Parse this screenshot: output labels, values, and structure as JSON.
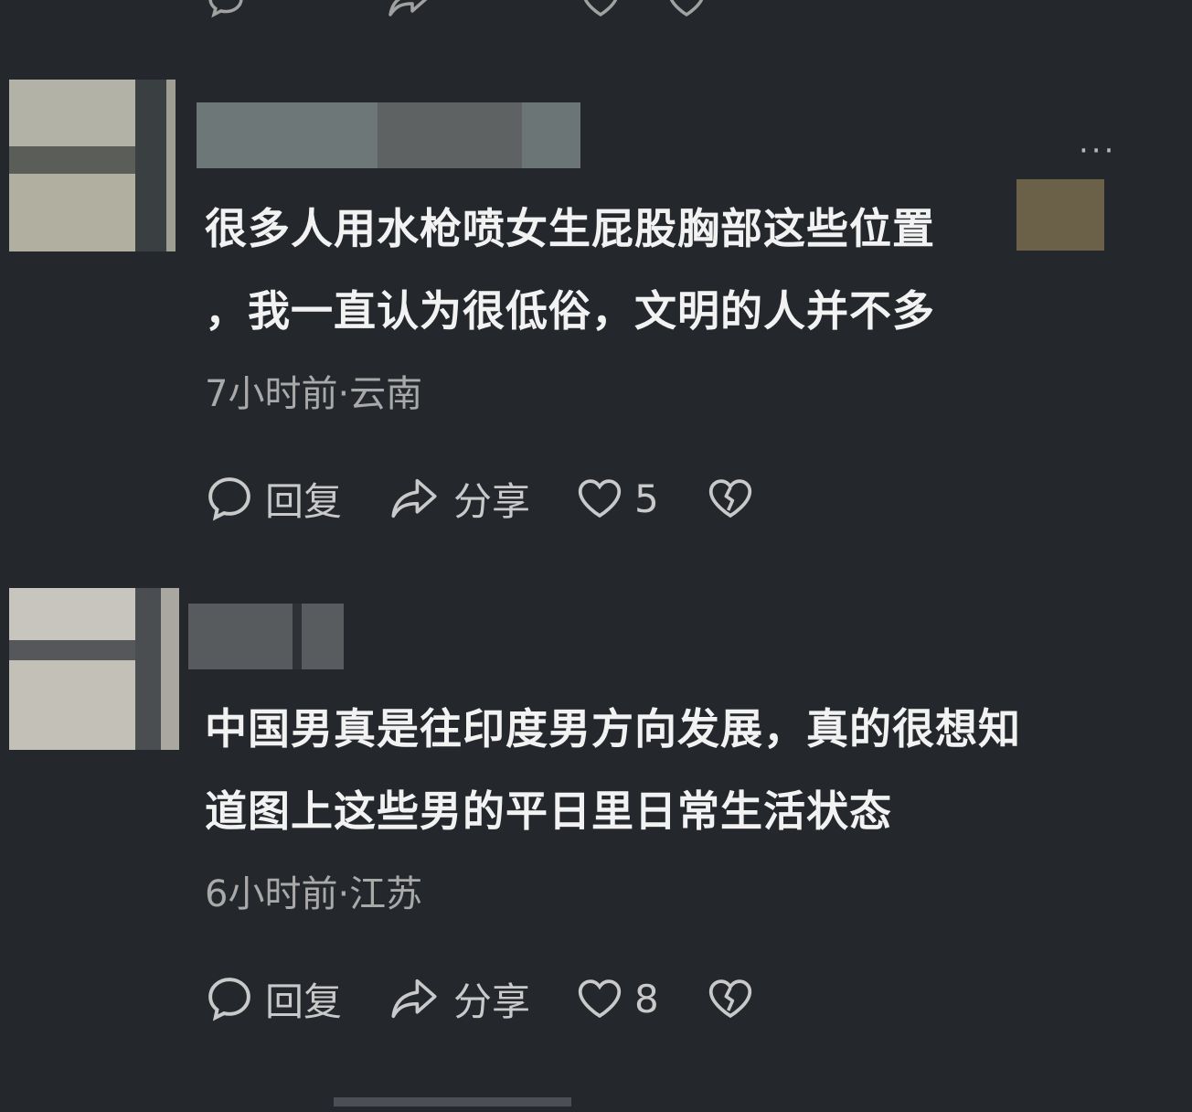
{
  "comments": [
    {
      "text_line1": "很多人用水枪喷女生屁股胸部这些位置",
      "text_line2": "，我一直认为很低俗，文明的人并不多",
      "meta": "7小时前·云南",
      "reply_label": "回复",
      "share_label": "分享",
      "like_count": "5"
    },
    {
      "text_line1": "中国男真是往印度男方向发展，真的很想知",
      "text_line2": "道图上这些男的平日里日常生活状态",
      "meta": "6小时前·江苏",
      "reply_label": "回复",
      "share_label": "分享",
      "like_count": "8"
    }
  ],
  "more_menu": "···",
  "icons": {
    "reply": "speech-bubble-icon",
    "share": "share-arrow-icon",
    "like": "heart-icon",
    "dislike": "broken-heart-icon"
  },
  "colors": {
    "background": "#24272c",
    "text": "#f2f2f2",
    "meta": "#a9a9a9"
  }
}
